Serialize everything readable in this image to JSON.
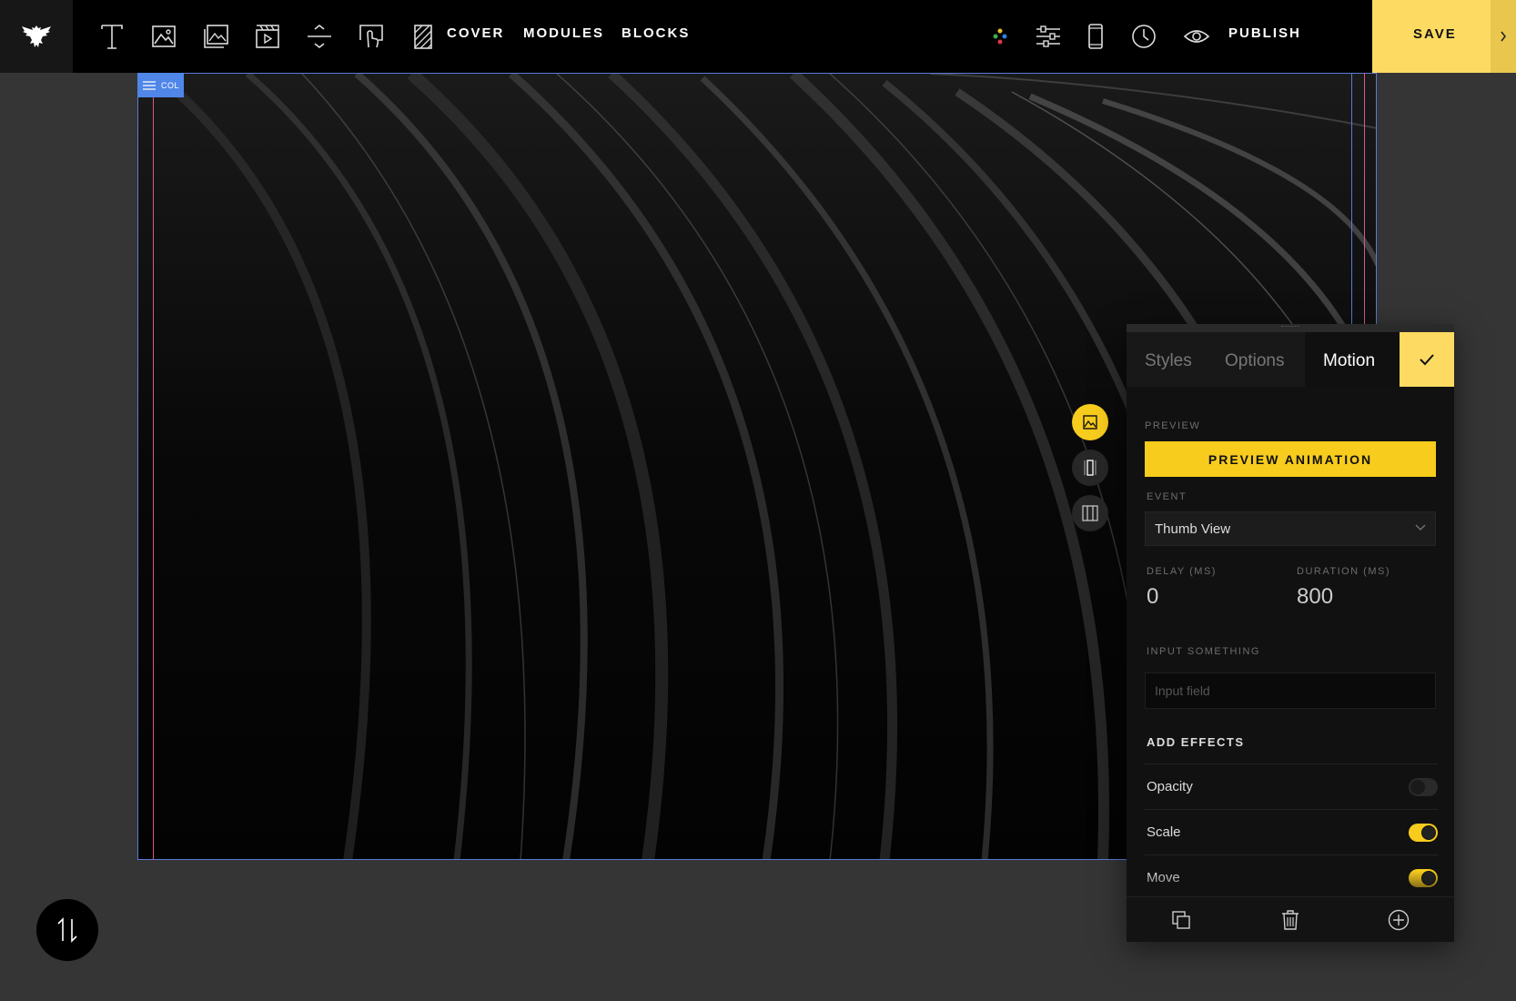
{
  "toolbar": {
    "logo": "eagle-logo",
    "tools": [
      "text-tool-icon",
      "image-tool-icon",
      "gallery-tool-icon",
      "video-tool-icon",
      "divider-tool-icon",
      "button-tool-icon",
      "pattern-tool-icon"
    ],
    "nav": {
      "cover": "COVER",
      "modules": "MODULES",
      "blocks": "BLOCKS"
    },
    "right_icons": [
      "colors-icon",
      "sliders-icon",
      "mobile-icon",
      "history-icon",
      "preview-eye-icon"
    ],
    "publish": "PUBLISH",
    "save": "SAVE"
  },
  "canvas": {
    "col_tag": "COL"
  },
  "panel": {
    "tabs": {
      "styles": "Styles",
      "options": "Options",
      "motion": "Motion"
    },
    "active_tab": "Motion",
    "preview_label": "PREVIEW",
    "preview_button": "PREVIEW ANIMATION",
    "event_label": "EVENT",
    "event_value": "Thumb View",
    "delay_label": "DELAY (MS)",
    "delay_value": "0",
    "duration_label": "DURATION (MS)",
    "duration_value": "800",
    "input_label": "INPUT SOMETHING",
    "input_placeholder": "Input field",
    "effects_title": "ADD EFFECTS",
    "effects": [
      {
        "name": "Opacity",
        "enabled": false
      },
      {
        "name": "Scale",
        "enabled": true
      },
      {
        "name": "Move",
        "enabled": true
      }
    ]
  },
  "colors": {
    "accent": "#f7cc1d",
    "save_bg": "#fddb62",
    "selection_blue": "#4f86e8",
    "guide_pink": "#d55a8b"
  }
}
